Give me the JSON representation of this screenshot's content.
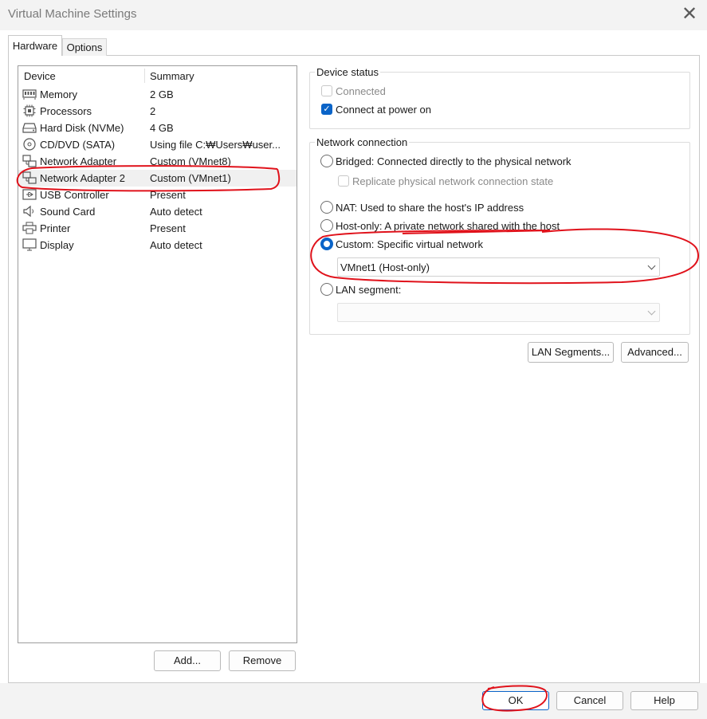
{
  "window": {
    "title": "Virtual Machine Settings",
    "close_glyph": "✕"
  },
  "tabs": [
    {
      "label": "Hardware",
      "active": true
    },
    {
      "label": "Options",
      "active": false
    }
  ],
  "device_list": {
    "columns": [
      "Device",
      "Summary"
    ],
    "rows": [
      {
        "device": "Memory",
        "summary": "2 GB",
        "icon": "memory-icon"
      },
      {
        "device": "Processors",
        "summary": "2",
        "icon": "processor-icon"
      },
      {
        "device": "Hard Disk (NVMe)",
        "summary": "4 GB",
        "icon": "hard-disk-icon"
      },
      {
        "device": "CD/DVD (SATA)",
        "summary": "Using file C:₩Users₩user...",
        "icon": "cd-dvd-icon"
      },
      {
        "device": "Network Adapter",
        "summary": "Custom (VMnet8)",
        "icon": "network-adapter-icon"
      },
      {
        "device": "Network Adapter 2",
        "summary": "Custom (VMnet1)",
        "icon": "network-adapter-icon",
        "selected": true
      },
      {
        "device": "USB Controller",
        "summary": "Present",
        "icon": "usb-icon"
      },
      {
        "device": "Sound Card",
        "summary": "Auto detect",
        "icon": "speaker-icon"
      },
      {
        "device": "Printer",
        "summary": "Present",
        "icon": "printer-icon"
      },
      {
        "device": "Display",
        "summary": "Auto detect",
        "icon": "monitor-icon"
      }
    ],
    "add_label": "Add...",
    "remove_label": "Remove"
  },
  "device_status": {
    "title": "Device status",
    "connected_label": "Connected",
    "connected_checked": false,
    "connected_enabled": false,
    "power_on_label": "Connect at power on",
    "power_on_checked": true
  },
  "network_connection": {
    "title": "Network connection",
    "bridged_label": "Bridged: Connected directly to the physical network",
    "replicate_label": "Replicate physical network connection state",
    "nat_label": "NAT: Used to share the host's IP address",
    "host_only_label": "Host-only: A private network shared with the host",
    "custom_label": "Custom: Specific virtual network",
    "custom_value": "VMnet1 (Host-only)",
    "lan_label": "LAN segment:",
    "lan_value": "",
    "selected": "custom",
    "lan_segments_label": "LAN Segments...",
    "advanced_label": "Advanced..."
  },
  "footer": {
    "ok_label": "OK",
    "cancel_label": "Cancel",
    "help_label": "Help"
  },
  "colors": {
    "accent": "#0a64c8",
    "annotation": "#e0121b",
    "selection": "#f0f0f0"
  }
}
